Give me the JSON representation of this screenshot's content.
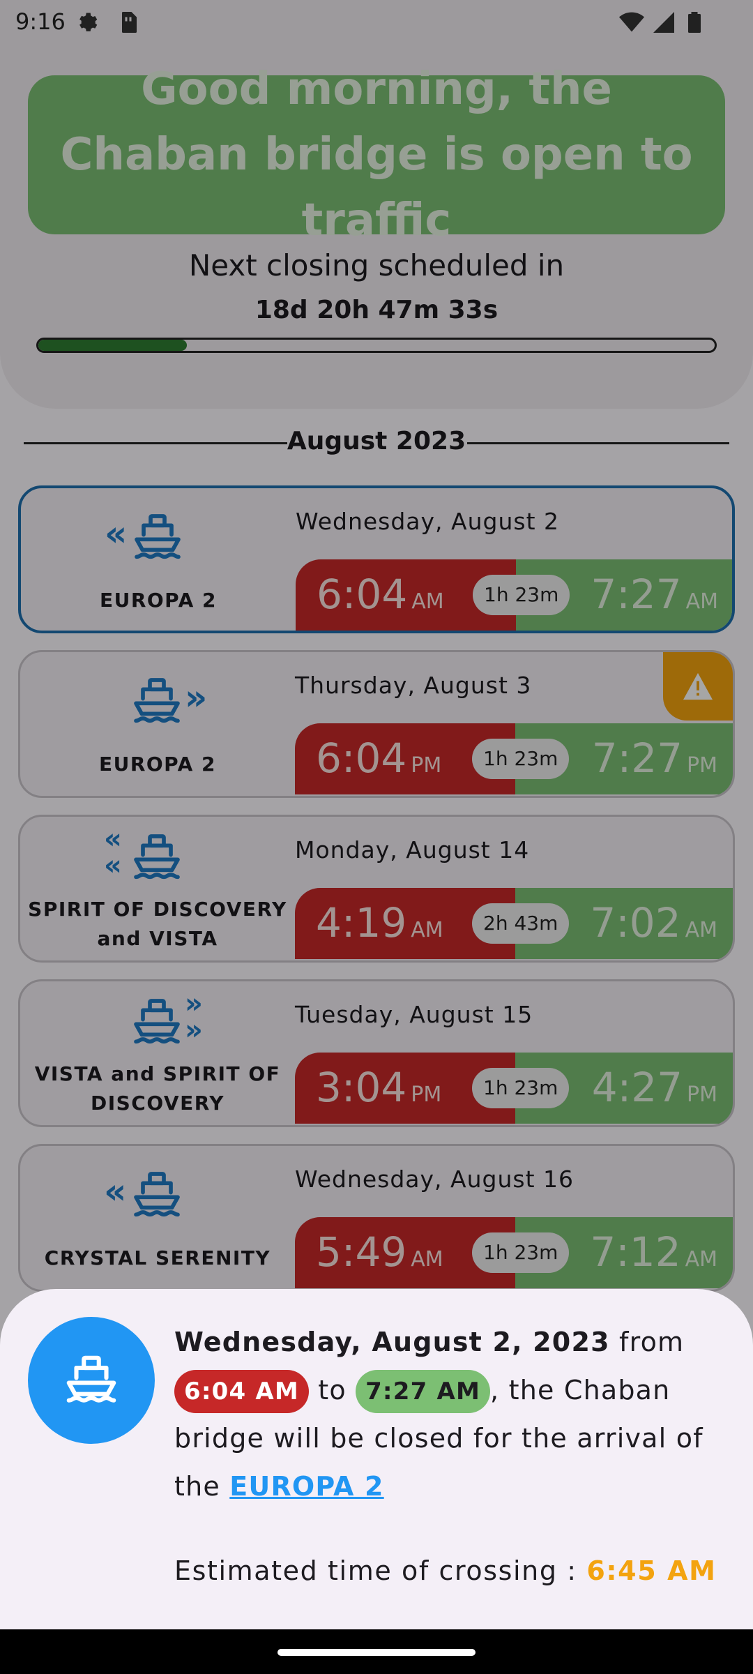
{
  "status_bar": {
    "time": "9:16"
  },
  "header": {
    "status_message": "Good morning, the Chaban bridge is open to traffic",
    "next_closing_label": "Next closing scheduled in",
    "countdown": "18d 20h 47m 33s",
    "progress_fraction": 0.22
  },
  "month": {
    "label": "August 2023"
  },
  "closings": [
    {
      "boat": "EUROPA 2",
      "direction": "in",
      "date": "Wednesday, August 2",
      "start": "6:04",
      "start_suffix": "AM",
      "duration": "1h 23m",
      "end": "7:27",
      "end_suffix": "AM",
      "selected": true,
      "warning": false
    },
    {
      "boat": "EUROPA 2",
      "direction": "out",
      "date": "Thursday, August 3",
      "start": "6:04",
      "start_suffix": "PM",
      "duration": "1h 23m",
      "end": "7:27",
      "end_suffix": "PM",
      "selected": false,
      "warning": true
    },
    {
      "boat": "SPIRIT OF DISCOVERY and VISTA",
      "direction": "in-double",
      "date": "Monday, August 14",
      "start": "4:19",
      "start_suffix": "AM",
      "duration": "2h 43m",
      "end": "7:02",
      "end_suffix": "AM",
      "selected": false,
      "warning": false
    },
    {
      "boat": "VISTA and SPIRIT OF DISCOVERY",
      "direction": "out-double",
      "date": "Tuesday, August 15",
      "start": "3:04",
      "start_suffix": "PM",
      "duration": "1h 23m",
      "end": "4:27",
      "end_suffix": "PM",
      "selected": false,
      "warning": false
    },
    {
      "boat": "CRYSTAL SERENITY",
      "direction": "in",
      "date": "Wednesday, August 16",
      "start": "5:49",
      "start_suffix": "AM",
      "duration": "1h 23m",
      "end": "7:12",
      "end_suffix": "AM",
      "selected": false,
      "warning": false
    }
  ],
  "sheet": {
    "date_full": "Wednesday, August 2, 2023",
    "from_word": "from",
    "start_chip": "6:04 AM",
    "to_word": "to",
    "end_chip": "7:27 AM",
    "middle_text": ", the Chaban bridge will be closed for the arrival of the",
    "boat_link": "EUROPA 2",
    "estimate_label": "Estimated time of crossing :",
    "estimate_value": "6:45 AM"
  },
  "icons": {
    "boat": "ship-icon",
    "warning": "warning-icon",
    "settings": "gear-icon",
    "sim": "sim-card-icon",
    "wifi": "wifi-icon",
    "signal": "signal-icon",
    "battery": "battery-icon"
  },
  "colors": {
    "open_green": "#7cbf73",
    "closed_red": "#c62828",
    "accent_blue": "#2196f3",
    "warning_orange": "#f3a30f"
  }
}
